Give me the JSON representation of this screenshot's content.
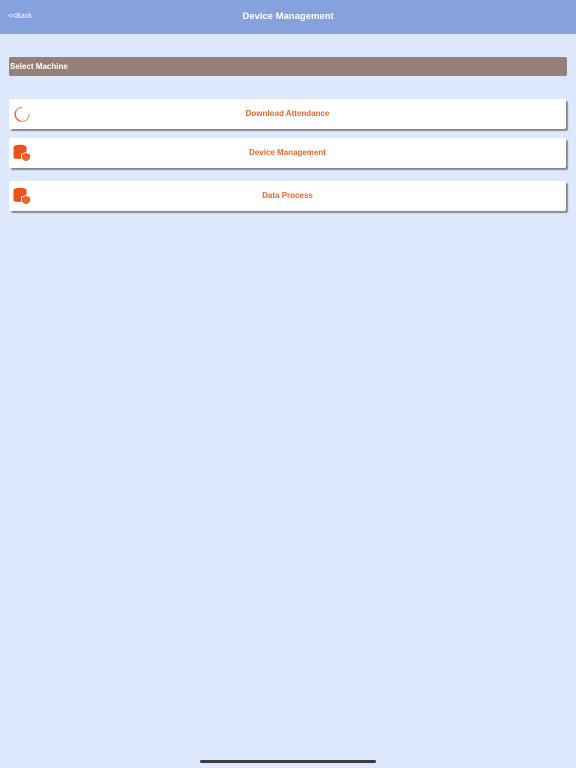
{
  "header": {
    "back_label": "<<Back",
    "title": "Device Management"
  },
  "select_machine": {
    "label": "Select Machine"
  },
  "menu": [
    {
      "label": "Download Attendance",
      "icon": "loading-spinner-icon"
    },
    {
      "label": "Device Management",
      "icon": "database-shield-icon"
    },
    {
      "label": "Data Process",
      "icon": "database-shield-icon"
    }
  ],
  "colors": {
    "nav_bar": "#86a2de",
    "background": "#dde8fc",
    "select_bar": "#958076",
    "accent": "#f0632a"
  }
}
